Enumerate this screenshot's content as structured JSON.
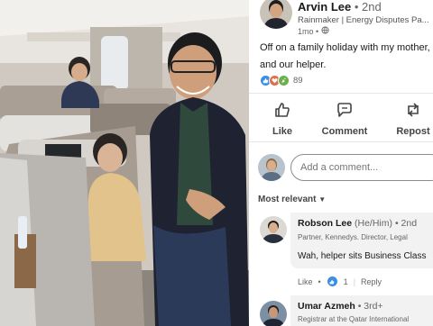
{
  "post": {
    "author_name": "Arvin Lee",
    "author_degree": "• 2nd",
    "author_headline": "Rainmaker | Energy Disputes Pa...",
    "author_time": "1mo •",
    "text": "Off on a family holiday with my mother, and our helper.",
    "reaction_count": "89",
    "reaction_icons": [
      "like-icon",
      "heart-icon",
      "celebrate-icon"
    ]
  },
  "actions": [
    {
      "label": "Like",
      "icon": "thumbs-up-icon"
    },
    {
      "label": "Comment",
      "icon": "comment-icon"
    },
    {
      "label": "Repost",
      "icon": "repost-icon"
    }
  ],
  "comment_input": {
    "placeholder": "Add a comment..."
  },
  "sort": {
    "label": "Most relevant"
  },
  "comments": [
    {
      "name": "Robson Lee",
      "pronouns": "(He/Him)",
      "degree": "• 2nd",
      "headline": "Partner, Kennedys. Director, Legal",
      "text": "Wah, helper sits Business Class",
      "like_label": "Like",
      "reaction_count": "1",
      "reply_label": "Reply"
    },
    {
      "name": "Umar Azmeh",
      "degree": "• 3rd+",
      "headline": "Registrar at the Qatar International"
    }
  ],
  "colors": {
    "like_blue": "#378fe9",
    "heart_red": "#df704d",
    "text_dark": "#191919",
    "text_muted": "#666666"
  }
}
